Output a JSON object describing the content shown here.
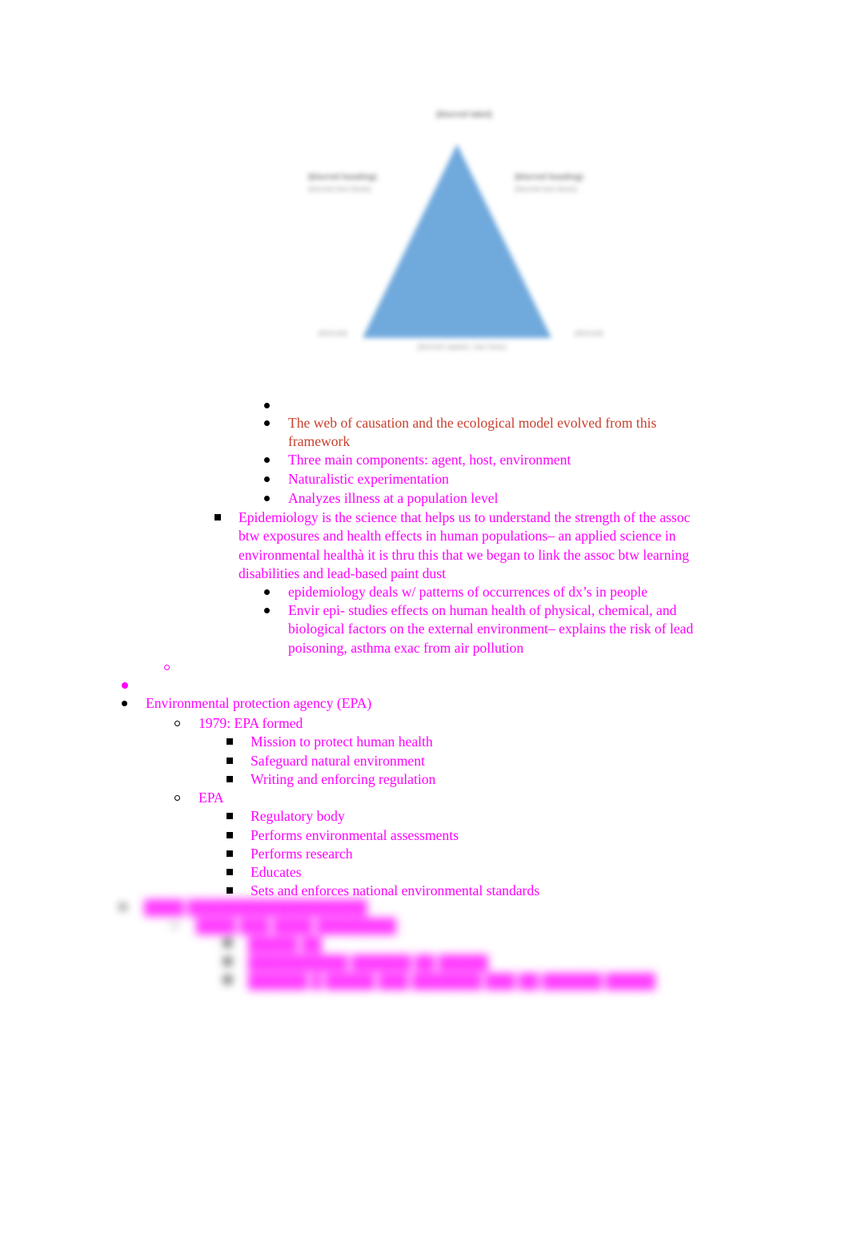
{
  "document": {
    "title": "Environmental Health Study Notes",
    "background_color": "#ffffff",
    "text_colors": {
      "magenta": "#ff00ff",
      "brick_red": "#c8402e",
      "black": "#000000",
      "diagram_triangle": "#70a9dc",
      "diagram_label_gray": "#8d8d8d"
    }
  },
  "diagram": {
    "name": "epidemiologic-triangle",
    "description": "Blurred epidemiologic triangle illustration with a solid blue triangle and unreadable gray caption blocks at the apex, left, right and base.",
    "triangle_color": "#70a9dc",
    "legible": false,
    "labels": {
      "top": "(blurred label)",
      "left_heading": "(blurred heading)",
      "left_body": "(blurred text block)",
      "right_heading": "(blurred heading)",
      "right_body": "(blurred text block)",
      "bottom_left": "(blurred)",
      "bottom_right": "(blurred)",
      "bottom_caption": "(blurred caption, two lines)"
    }
  },
  "outline": [
    {
      "id": "b1",
      "marker": "disc",
      "marker_color": "black",
      "text": "",
      "color": "magenta",
      "indent": 1,
      "empty": true
    },
    {
      "id": "b2",
      "marker": "disc",
      "marker_color": "black",
      "text": "The web of causation and the ecological model evolved from this framework",
      "color": "brick_red",
      "indent": 1
    },
    {
      "id": "b3",
      "marker": "disc",
      "marker_color": "black",
      "text": "Three main components: agent, host, environment",
      "color": "magenta",
      "indent": 1
    },
    {
      "id": "b4",
      "marker": "disc",
      "marker_color": "black",
      "text": "Naturalistic experimentation",
      "color": "magenta",
      "indent": 1
    },
    {
      "id": "b5",
      "marker": "disc",
      "marker_color": "black",
      "text": "Analyzes illness at a population level",
      "color": "magenta",
      "indent": 1
    },
    {
      "id": "b6",
      "marker": "square",
      "marker_color": "black",
      "text": "Epidemiology is the science that helps us to understand the strength of the assoc btw exposures and health effects in human populations– an applied science in environmental healthà  it is thru this that we began to link the assoc btw learning disabilities and lead-based paint dust",
      "color": "magenta",
      "indent": 0
    },
    {
      "id": "b7",
      "marker": "disc",
      "marker_color": "black",
      "text": "epidemiology deals w/ patterns of occurrences of dx’s in people",
      "color": "magenta",
      "indent": 1
    },
    {
      "id": "b8",
      "marker": "disc",
      "marker_color": "black",
      "text": "Envir epi- studies effects on human health of physical, chemical, and biological factors on the external environment– explains the risk of lead poisoning, asthma exac from air pollution",
      "color": "magenta",
      "indent": 1
    },
    {
      "id": "b9",
      "marker": "circle",
      "marker_color": "magenta",
      "text": "",
      "color": "magenta",
      "empty": true
    },
    {
      "id": "b10",
      "marker": "disc",
      "marker_color": "magenta",
      "text": "",
      "color": "magenta",
      "empty": true
    },
    {
      "id": "b11",
      "marker": "disc",
      "marker_color": "black",
      "text": "Environmental protection agency (EPA)",
      "color": "magenta"
    },
    {
      "id": "b12",
      "marker": "circle",
      "marker_color": "black",
      "text": "1979: EPA formed",
      "color": "magenta"
    },
    {
      "id": "b13",
      "marker": "square",
      "marker_color": "black",
      "text": "Mission to protect human health",
      "color": "magenta"
    },
    {
      "id": "b14",
      "marker": "square",
      "marker_color": "black",
      "text": "Safeguard natural environment",
      "color": "magenta"
    },
    {
      "id": "b15",
      "marker": "square",
      "marker_color": "black",
      "text": "Writing and enforcing regulation",
      "color": "magenta"
    },
    {
      "id": "b16",
      "marker": "circle",
      "marker_color": "black",
      "text": "EPA",
      "color": "magenta"
    },
    {
      "id": "b17",
      "marker": "square",
      "marker_color": "black",
      "text": "Regulatory body",
      "color": "magenta"
    },
    {
      "id": "b18",
      "marker": "square",
      "marker_color": "black",
      "text": "Performs environmental assessments",
      "color": "magenta"
    },
    {
      "id": "b19",
      "marker": "square",
      "marker_color": "black",
      "text": "Performs research",
      "color": "magenta"
    },
    {
      "id": "b20",
      "marker": "square",
      "marker_color": "black",
      "text": "Educates",
      "color": "magenta"
    },
    {
      "id": "b21",
      "marker": "square",
      "marker_color": "black",
      "text": "Sets and enforces national environmental standards",
      "color": "magenta"
    }
  ],
  "blurred_section": {
    "legible": false,
    "note": "Bottom outline block is heavily blurred and unreadable.",
    "rows": [
      {
        "marker": "disc",
        "text": "████  ██████████████████"
      },
      {
        "marker": "circle",
        "text": "████ ███ ████ ████████"
      },
      {
        "marker": "square",
        "text": "█████ ██"
      },
      {
        "marker": "square",
        "text": "██████████ ██████ ██ █████"
      },
      {
        "marker": "square",
        "text": "██████ █ █████ ███ ███████ ███ ██ ██████ █████"
      }
    ]
  }
}
